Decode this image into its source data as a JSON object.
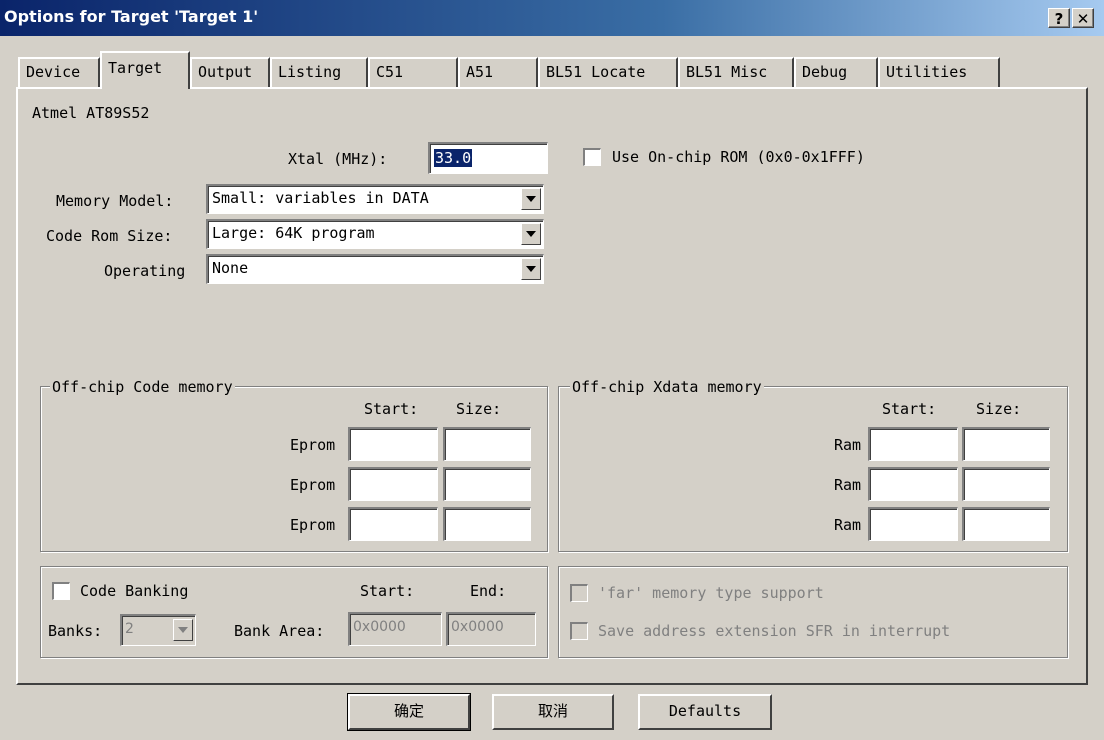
{
  "window": {
    "title": "Options for Target 'Target 1'",
    "help_btn": "?",
    "close_btn": "✕"
  },
  "tabs": [
    {
      "label": "Device"
    },
    {
      "label": "Target"
    },
    {
      "label": "Output"
    },
    {
      "label": "Listing"
    },
    {
      "label": "C51"
    },
    {
      "label": "A51"
    },
    {
      "label": "BL51 Locate"
    },
    {
      "label": "BL51 Misc"
    },
    {
      "label": "Debug"
    },
    {
      "label": "Utilities"
    }
  ],
  "device": {
    "name": "Atmel AT89S52"
  },
  "xtal": {
    "label": "Xtal (MHz):",
    "value": "33.0"
  },
  "use_onchip_rom": {
    "label": "Use On-chip ROM (0x0-0x1FFF)",
    "checked": false
  },
  "memory_model": {
    "label": "Memory Model:",
    "value": "Small: variables in DATA"
  },
  "code_rom_size": {
    "label": "Code Rom Size:",
    "value": "Large: 64K program"
  },
  "operating": {
    "label": "Operating",
    "value": "None"
  },
  "code_memory": {
    "title": "Off-chip Code memory",
    "start_header": "Start:",
    "size_header": "Size:",
    "rows": [
      {
        "label": "Eprom"
      },
      {
        "label": "Eprom"
      },
      {
        "label": "Eprom"
      }
    ]
  },
  "xdata_memory": {
    "title": "Off-chip Xdata memory",
    "start_header": "Start:",
    "size_header": "Size:",
    "rows": [
      {
        "label": "Ram"
      },
      {
        "label": "Ram"
      },
      {
        "label": "Ram"
      }
    ]
  },
  "banking": {
    "checkbox_label": "Code Banking",
    "start_header": "Start:",
    "end_header": "End:",
    "banks_label": "Banks:",
    "banks_value": "2",
    "bank_area_label": "Bank Area:",
    "bank_start": "0x0000",
    "bank_end": "0x0000"
  },
  "far_options": {
    "far_support": "'far' memory type support",
    "save_sfr": "Save address extension SFR in interrupt"
  },
  "buttons": {
    "ok": "确定",
    "cancel": "取消",
    "defaults": "Defaults"
  },
  "colors": {
    "dialog_bg": "#d4d0c8",
    "title_start": "#0a246a",
    "title_end": "#a6caf0",
    "selection": "#0a246a"
  }
}
